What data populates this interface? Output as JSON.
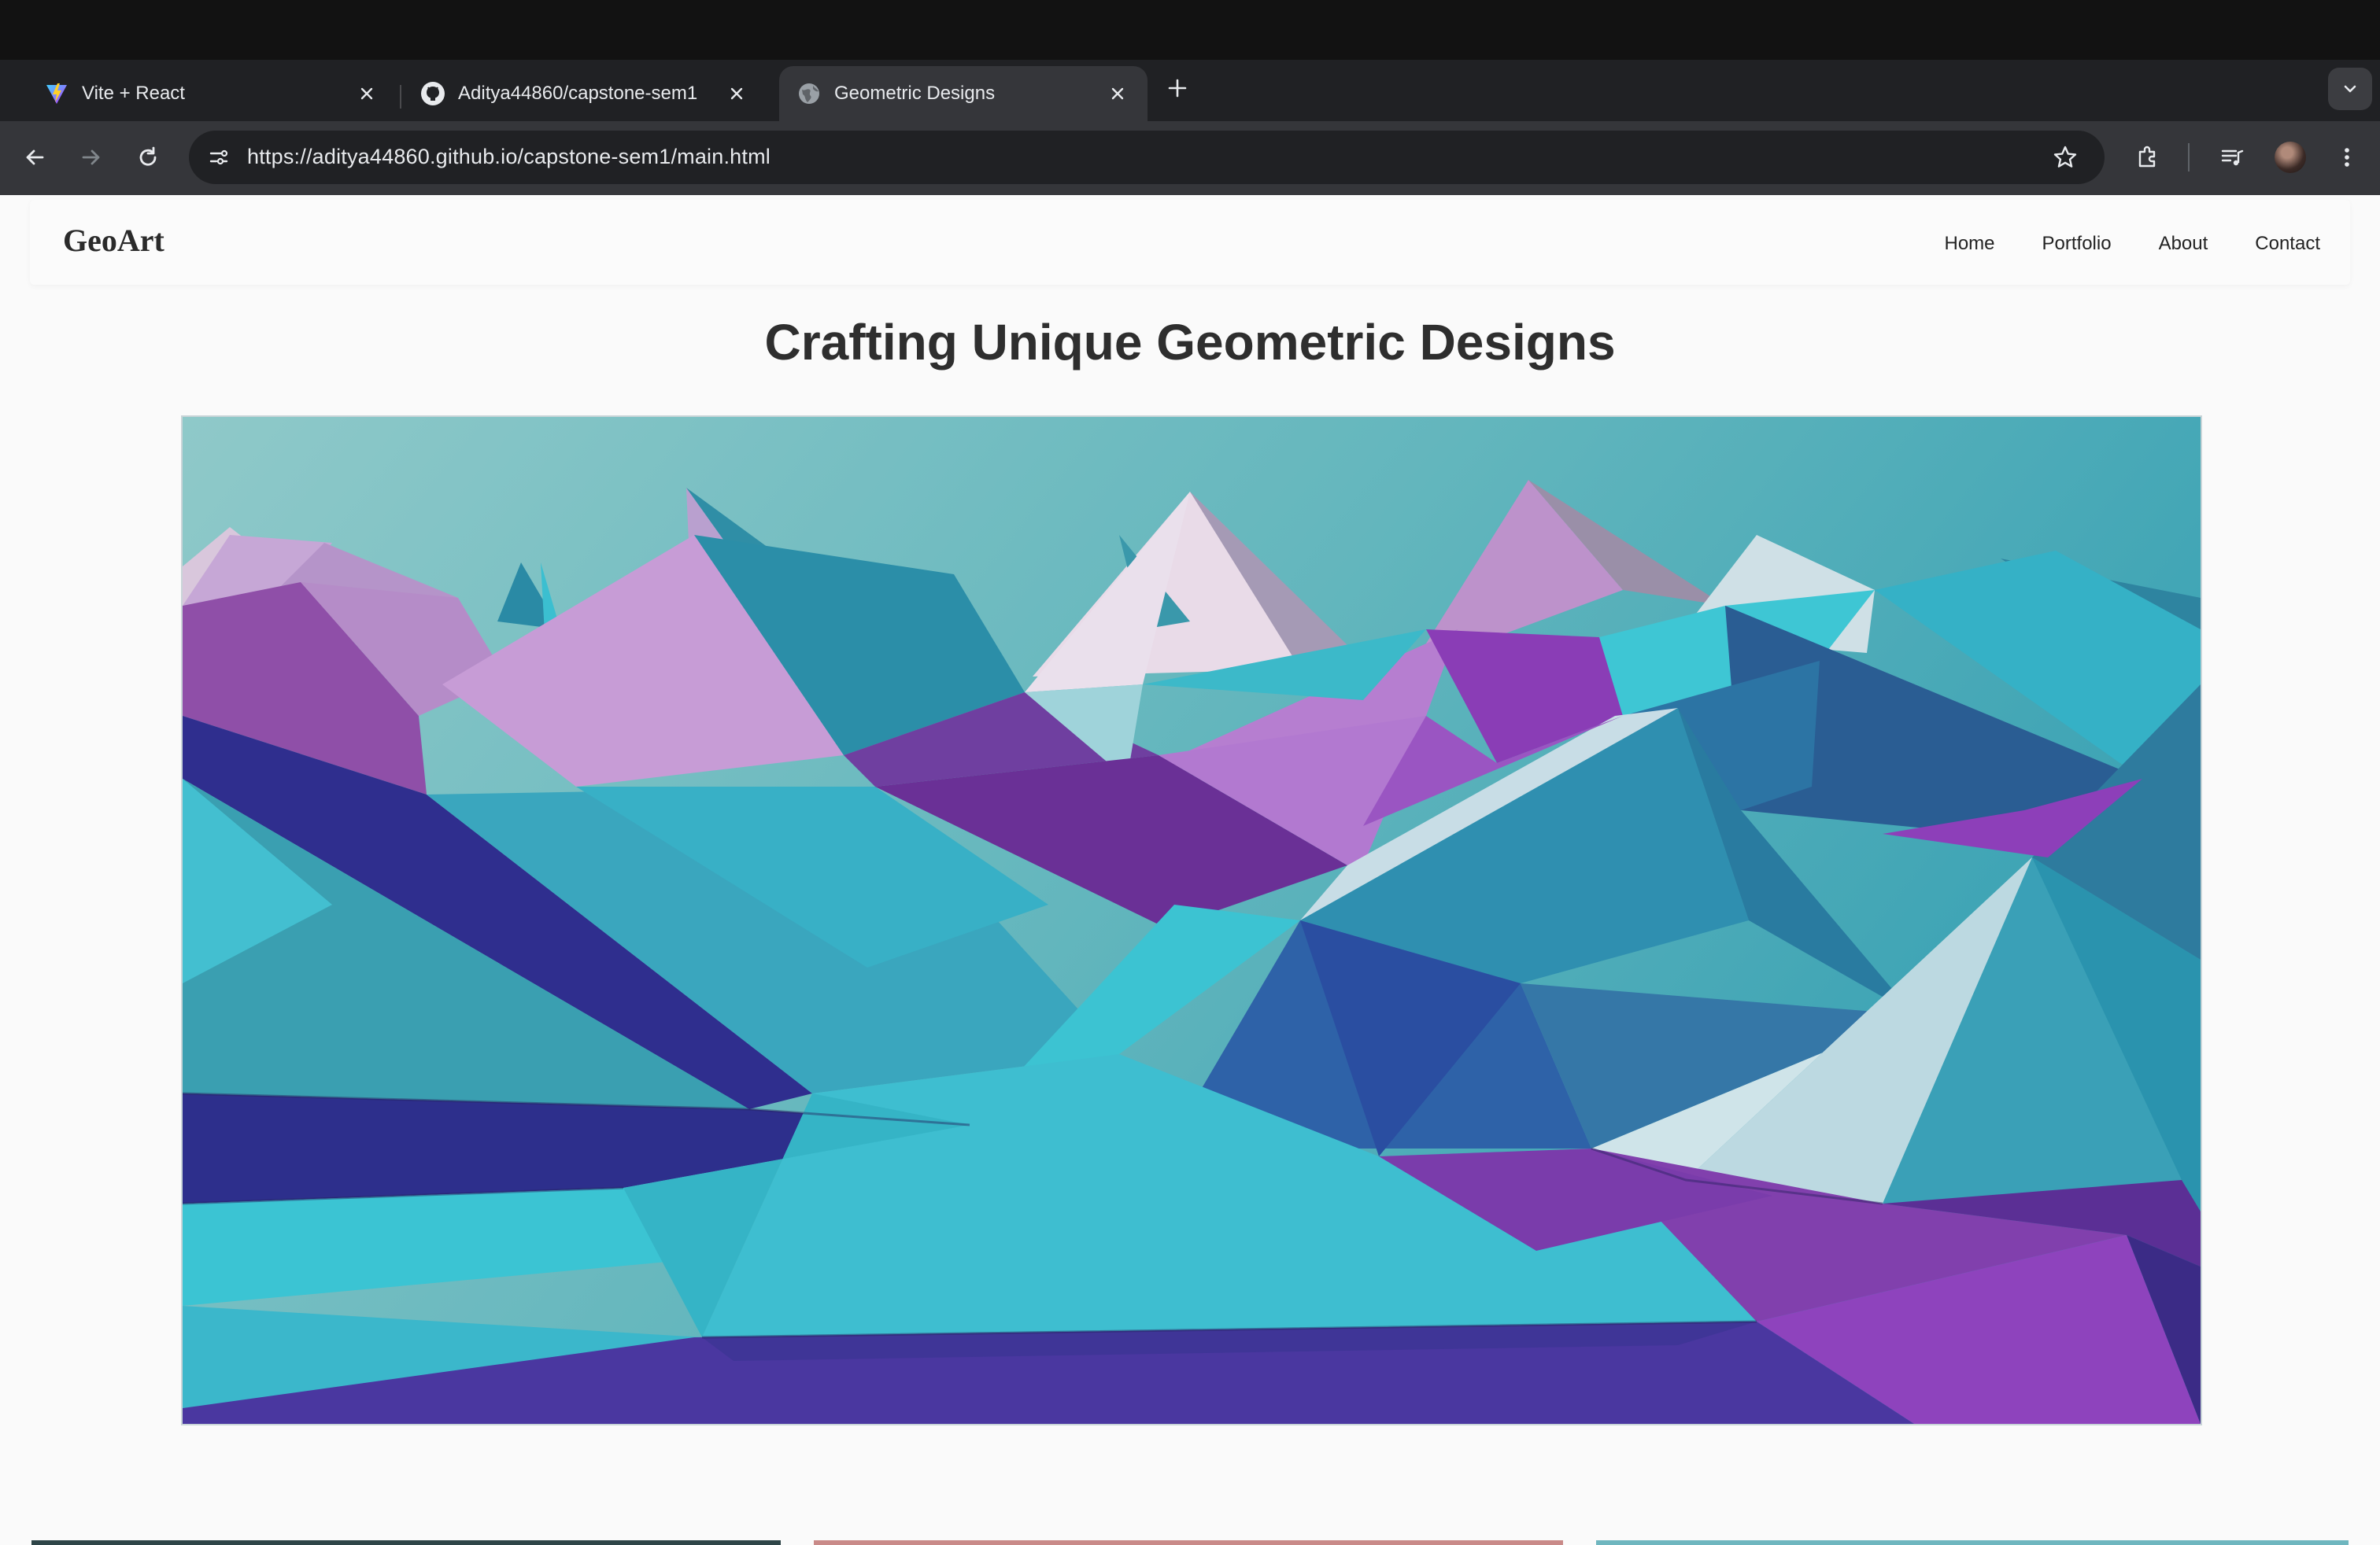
{
  "browser": {
    "tabs": [
      {
        "title": "Vite + React",
        "favicon": "vite-icon",
        "active": false
      },
      {
        "title": "Aditya44860/capstone-sem1",
        "favicon": "github-icon",
        "active": false
      },
      {
        "title": "Geometric Designs",
        "favicon": "globe-icon",
        "active": true
      }
    ],
    "url": "https://aditya44860.github.io/capstone-sem1/main.html"
  },
  "site": {
    "logo": "GeoArt",
    "nav": [
      "Home",
      "Portfolio",
      "About",
      "Contact"
    ],
    "hero_title": "Crafting Unique Geometric Designs"
  },
  "colors": {
    "page_bg": "#fafafa",
    "title_text": "#2e2e2e",
    "art_teal": "#3cc3d2",
    "art_purple": "#8a44b8",
    "art_navy": "#2e3591"
  }
}
